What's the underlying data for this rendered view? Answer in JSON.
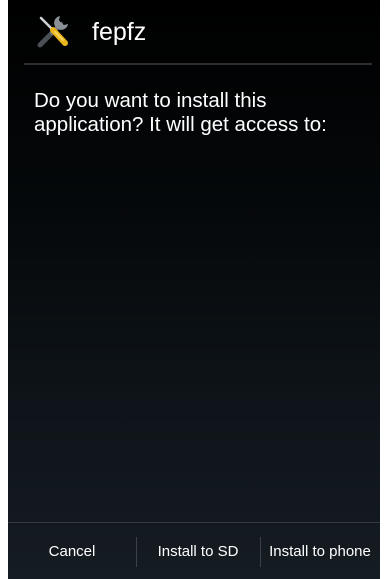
{
  "dialog": {
    "app_name": "fepfz",
    "app_icon": "screwdriver-wrench-icon",
    "message": "Do you want to install this application? It will get access to:"
  },
  "buttons": {
    "cancel": "Cancel",
    "install_sd": "Install to SD",
    "install_phone": "Install to phone"
  },
  "colors": {
    "background_top": "#000000",
    "background_bottom": "#151c22",
    "text": "#ffffff",
    "divider": "#2b2f33",
    "icon_handle": "#e8b51c"
  }
}
